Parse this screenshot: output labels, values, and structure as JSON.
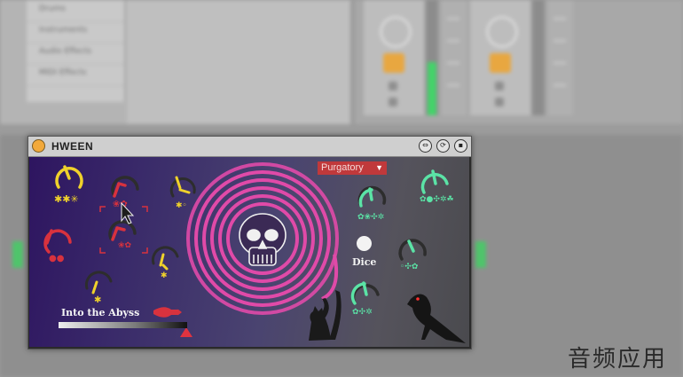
{
  "background": {
    "browser_items": [
      "Drums",
      "Instruments",
      "Audio Effects",
      "MIDI Effects"
    ],
    "accent_colors": {
      "meter_green": "#44d36a",
      "solo_orange": "#e8a740"
    }
  },
  "device": {
    "title": "HWEEN",
    "title_buttons": [
      "map-icon",
      "hot-swap-icon",
      "save-icon"
    ],
    "preset_menu": {
      "selected": "Purgatory"
    },
    "dice_label": "Dice",
    "abyss_label": "Into the Abyss",
    "knob_colors": {
      "yellow": "#f0d22b",
      "red": "#d8323e",
      "green": "#5be3a6",
      "pink": "#d43a9a"
    }
  },
  "watermark": "音频应用"
}
